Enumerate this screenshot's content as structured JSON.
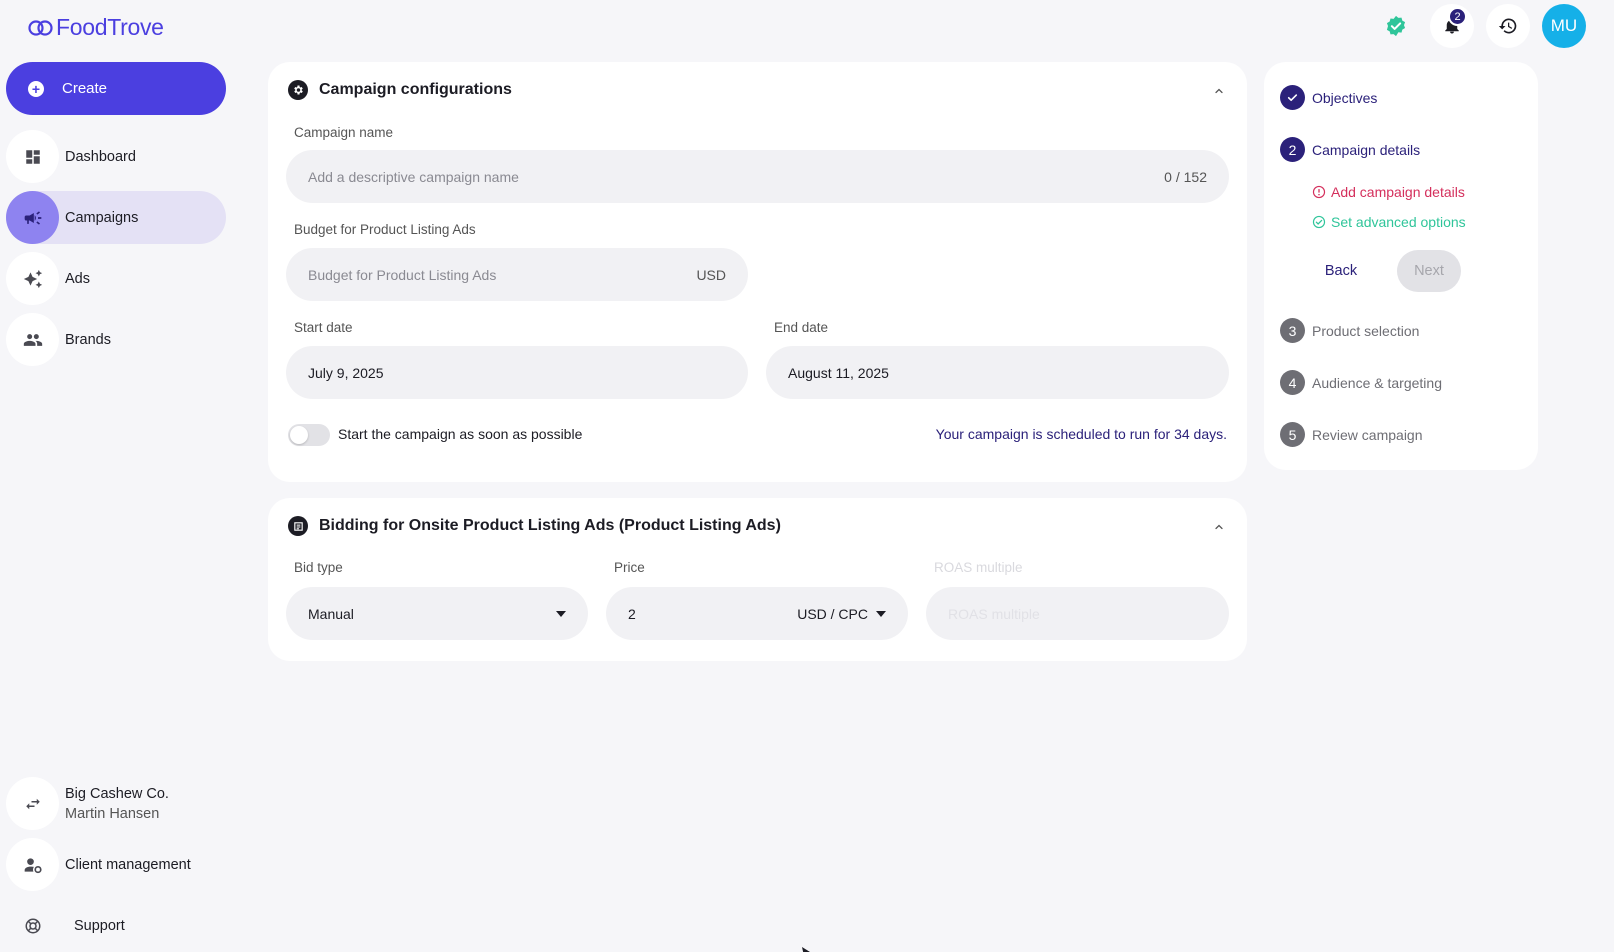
{
  "app": {
    "logo_text": "FoodTrove",
    "notification_count": "2",
    "avatar_initials": "MU"
  },
  "colors": {
    "primary": "#4b3fe0",
    "dark_accent": "#2b217a",
    "active_nav": "#e4e1f5",
    "error": "#d42f5c",
    "success": "#2fc59a",
    "avatar": "#15b0e8"
  },
  "sidebar": {
    "create_label": "Create",
    "items": [
      {
        "label": "Dashboard",
        "icon": "dashboard-icon"
      },
      {
        "label": "Campaigns",
        "icon": "megaphone-icon",
        "active": true
      },
      {
        "label": "Ads",
        "icon": "sparkle-icon"
      },
      {
        "label": "Brands",
        "icon": "people-icon"
      }
    ],
    "account": {
      "company": "Big Cashew Co.",
      "user": "Martin Hansen",
      "icon": "swap-icon"
    },
    "client_management": {
      "label": "Client management",
      "icon": "user-gear-icon"
    },
    "support": {
      "label": "Support",
      "icon": "lifebuoy-icon"
    }
  },
  "config_card": {
    "title": "Campaign configurations",
    "campaign_name": {
      "label": "Campaign name",
      "placeholder": "Add a descriptive campaign name",
      "counter": "0 / 152"
    },
    "budget": {
      "label": "Budget for Product Listing Ads",
      "placeholder": "Budget for Product Listing Ads",
      "currency": "USD"
    },
    "start_date": {
      "label": "Start date",
      "value": "July 9, 2025"
    },
    "end_date": {
      "label": "End date",
      "value": "August 11, 2025"
    },
    "asap_toggle": {
      "label": "Start the campaign as soon as possible",
      "on": false
    },
    "schedule_note": "Your campaign is scheduled to run for 34 days."
  },
  "bidding_card": {
    "title": "Bidding for Onsite Product Listing Ads (Product Listing Ads)",
    "bid_type": {
      "label": "Bid type",
      "value": "Manual"
    },
    "price": {
      "label": "Price",
      "value": "2",
      "unit": "USD / CPC"
    },
    "roas": {
      "label": "ROAS multiple",
      "placeholder": "ROAS multiple"
    }
  },
  "stepper": {
    "steps": [
      {
        "num": "✓",
        "label": "Objectives",
        "state": "done"
      },
      {
        "num": "2",
        "label": "Campaign details",
        "state": "current"
      },
      {
        "num": "3",
        "label": "Product selection",
        "state": "todo"
      },
      {
        "num": "4",
        "label": "Audience & targeting",
        "state": "todo"
      },
      {
        "num": "5",
        "label": "Review campaign",
        "state": "todo"
      }
    ],
    "substeps": [
      {
        "label": "Add campaign details",
        "status": "error"
      },
      {
        "label": "Set advanced options",
        "status": "ok"
      }
    ],
    "back_label": "Back",
    "next_label": "Next"
  }
}
